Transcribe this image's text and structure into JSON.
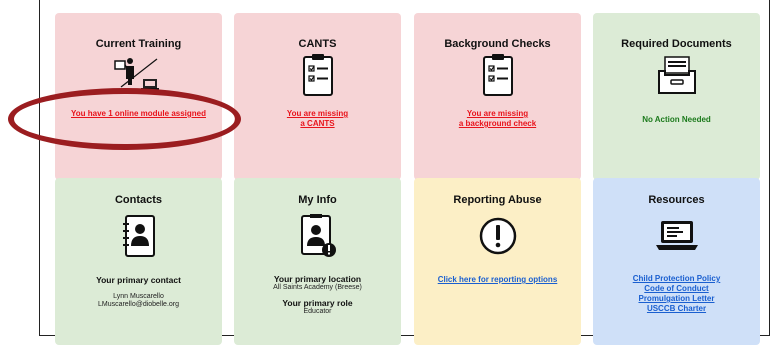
{
  "tiles": {
    "training": {
      "title": "Current Training",
      "link": "You have 1 online module assigned"
    },
    "cants": {
      "title": "CANTS",
      "link_line1": "You are missing",
      "link_line2": "a CANTS"
    },
    "background": {
      "title": "Background Checks",
      "link_line1": "You are missing",
      "link_line2": "a background check"
    },
    "documents": {
      "title": "Required Documents",
      "status": "No Action Needed"
    },
    "contacts": {
      "title": "Contacts",
      "heading": "Your primary contact",
      "name": "Lynn Muscarello",
      "email": "LMuscarello@diobelle.org"
    },
    "info": {
      "title": "My Info",
      "location_heading": "Your primary location",
      "location": "All Saints Academy (Breese)",
      "role_heading": "Your primary role",
      "role": "Educator"
    },
    "abuse": {
      "title": "Reporting Abuse",
      "link": "Click here for reporting options"
    },
    "resources": {
      "title": "Resources",
      "links": [
        "Child Protection Policy",
        "Code of Conduct",
        "Promulgation Letter",
        "USCCB Charter"
      ]
    }
  },
  "colors": {
    "red_tile": "#f6d4d6",
    "green_tile": "#dcebd6",
    "yellow_tile": "#fcefc6",
    "blue_tile": "#cfe0f8",
    "alert_link": "#e8141c",
    "info_link": "#1a5fd0",
    "annotation": "#9b1d20"
  },
  "icons": [
    "teacher-laptop-icon",
    "clipboard-checklist-icon",
    "clipboard-checklist-icon",
    "file-drawer-icon",
    "address-book-icon",
    "id-card-alert-icon",
    "exclamation-circle-icon",
    "laptop-document-icon"
  ]
}
